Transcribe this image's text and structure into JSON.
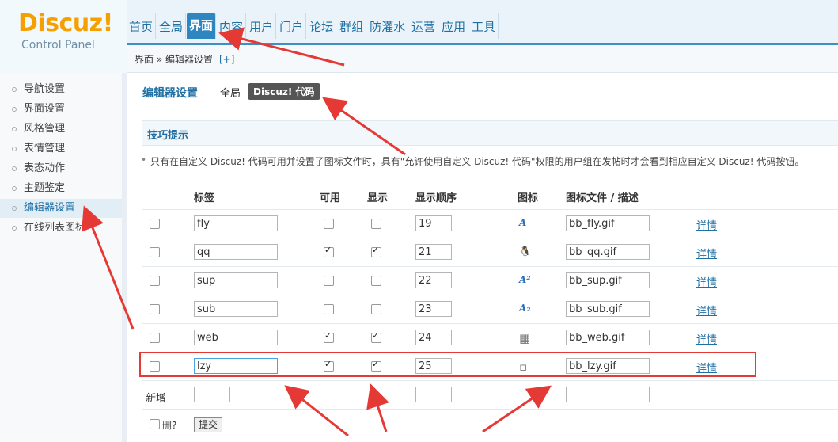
{
  "header": {
    "logo": "Discuz!",
    "logo_sub": "Control Panel",
    "nav": [
      "首页",
      "全局",
      "界面",
      "内容",
      "用户",
      "门户",
      "论坛",
      "群组",
      "防灌水",
      "运营",
      "应用",
      "工具"
    ],
    "active_nav": "界面"
  },
  "breadcrumb": {
    "text": "界面 » 编辑器设置",
    "toggle": "[+]"
  },
  "sidebar": {
    "items": [
      "导航设置",
      "界面设置",
      "风格管理",
      "表情管理",
      "表态动作",
      "主题鉴定",
      "编辑器设置",
      "在线列表图标"
    ],
    "active": "编辑器设置"
  },
  "page": {
    "title": "编辑器设置",
    "tabs": [
      "全局",
      "Discuz! 代码"
    ],
    "tips_title": "技巧提示",
    "tip": "只有在自定义 Discuz! 代码可用并设置了图标文件时，具有\"允许使用自定义 Discuz! 代码\"权限的用户组在发帖时才会看到相应自定义 Discuz! 代码按钮。"
  },
  "table": {
    "headers": [
      "标签",
      "可用",
      "显示",
      "显示顺序",
      "图标",
      "图标文件 / 描述"
    ],
    "rows": [
      {
        "tag": "fly",
        "available": false,
        "display": false,
        "order": "19",
        "icon": "font-italic-icon",
        "file": "bb_fly.gif",
        "link": "详情"
      },
      {
        "tag": "qq",
        "available": true,
        "display": true,
        "order": "21",
        "icon": "qq-penguin-icon",
        "file": "bb_qq.gif",
        "link": "详情"
      },
      {
        "tag": "sup",
        "available": false,
        "display": false,
        "order": "22",
        "icon": "superscript-icon",
        "file": "bb_sup.gif",
        "link": "详情"
      },
      {
        "tag": "sub",
        "available": false,
        "display": false,
        "order": "23",
        "icon": "subscript-icon",
        "file": "bb_sub.gif",
        "link": "详情"
      },
      {
        "tag": "web",
        "available": true,
        "display": true,
        "order": "24",
        "icon": "web-page-icon",
        "file": "bb_web.gif",
        "link": "详情"
      },
      {
        "tag": "lzy",
        "available": true,
        "display": true,
        "order": "25",
        "icon": "broken-image-icon",
        "file": "bb_lzy.gif",
        "link": "详情"
      }
    ],
    "add_label": "新增",
    "delete_label": "删?",
    "submit_label": "提交"
  },
  "colors": {
    "accent": "#2d86c0",
    "logo": "#f59f00",
    "highlight": "#e53935"
  }
}
